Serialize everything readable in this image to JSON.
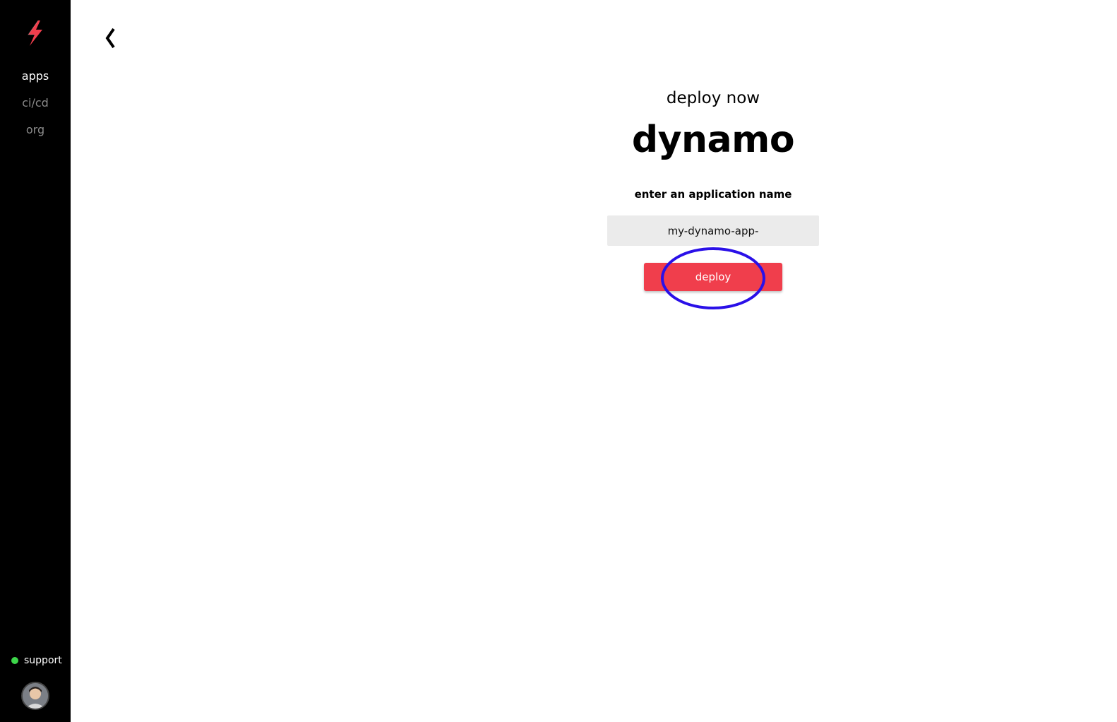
{
  "colors": {
    "sidebar_bg": "#000000",
    "accent": "#f03e4c",
    "status_online": "#3dd64a",
    "annotation": "#2a10e8",
    "input_bg": "#ebebeb"
  },
  "sidebar": {
    "logo_icon": "lightning-bolt-icon",
    "items": [
      {
        "label": "apps",
        "active": true
      },
      {
        "label": "ci/cd",
        "active": false
      },
      {
        "label": "org",
        "active": false
      }
    ],
    "support": {
      "label": "support",
      "status": "online"
    },
    "avatar_icon": "user-avatar"
  },
  "header": {
    "back_icon": "chevron-left-icon"
  },
  "main": {
    "subtitle": "deploy now",
    "title": "dynamo",
    "field_label": "enter an application name",
    "app_name_value": "my-dynamo-app-",
    "deploy_label": "deploy"
  },
  "annotation": {
    "shape": "ellipse",
    "target": "deploy-button"
  }
}
